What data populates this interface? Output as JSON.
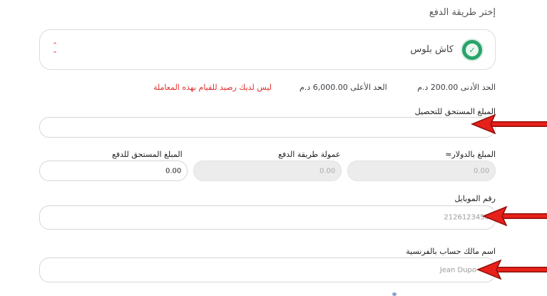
{
  "payment": {
    "section_title": "إختر طريقة الدفع",
    "selected_method": "كاش بلوس",
    "logo_icon": "cashplus-logo-icon"
  },
  "limits": {
    "min_text": "الحد الأدنى 200.00 د.م",
    "separator": "-",
    "max_text": "الحد الأعلى 6,000.00 د.م",
    "error": "ليس لديك رصيد للقيام بهذه المعاملة"
  },
  "fields": {
    "amount_due_label": "المبلغ المستحق للتحصيل",
    "amount_due_value": "",
    "usd_label": "المبلغ بالدولار≈",
    "usd_value": "0.00",
    "fee_label": "عمولة طريقة الدفع",
    "fee_value": "0.00",
    "pay_label": "المبلغ المستحق للدفع",
    "pay_value": "0.00",
    "mobile_label": "رقم الموبايل",
    "mobile_placeholder": "2126123456",
    "owner_label": "اسم مالك حساب بالفرنسية",
    "owner_placeholder": "Jean Dupo"
  },
  "annotations": {
    "arrow_color": "#e8201a"
  }
}
